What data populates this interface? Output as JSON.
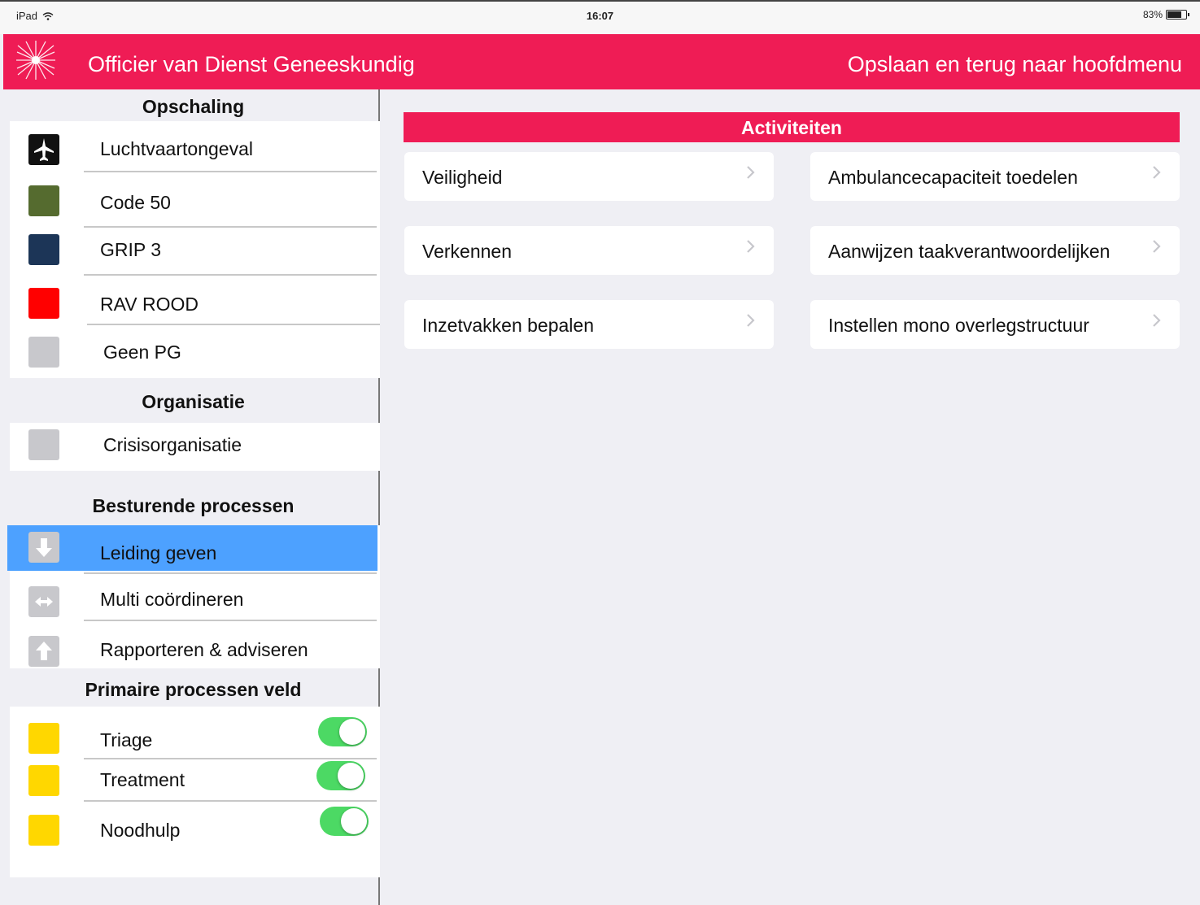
{
  "status_bar": {
    "carrier": "iPad",
    "time": "16:07",
    "battery_text": "83%",
    "battery_level": 0.83
  },
  "header": {
    "title": "Officier van Dienst Geneeskundig",
    "save_back_label": "Opslaan en terug naar hoofdmenu",
    "accent_color": "#ef1c55"
  },
  "sidebar": {
    "sections": {
      "opschaling": "Opschaling",
      "organisatie": "Organisatie",
      "besturende": "Besturende processen",
      "primaire": "Primaire processen veld"
    },
    "opschaling_items": [
      {
        "label": "Luchtvaartongeval",
        "color": "#111111",
        "icon": "airplane-icon"
      },
      {
        "label": "Code 50",
        "color": "#556b2f",
        "icon": "color-square"
      },
      {
        "label": "GRIP 3",
        "color": "#1c3557",
        "icon": "color-square"
      },
      {
        "label": "RAV ROOD",
        "color": "#ff0000",
        "icon": "color-square"
      },
      {
        "label": "Geen PG",
        "color": "#c8c8cc",
        "icon": "color-square"
      }
    ],
    "organisatie_items": [
      {
        "label": "Crisisorganisatie",
        "color": "#c8c8cc"
      }
    ],
    "besturende_items": [
      {
        "label": "Leiding geven",
        "icon": "arrow-down-icon",
        "selected": true
      },
      {
        "label": "Multi coördineren",
        "icon": "arrow-left-right-icon",
        "selected": false
      },
      {
        "label": "Rapporteren & adviseren",
        "icon": "arrow-up-icon",
        "selected": false
      }
    ],
    "primaire_items": [
      {
        "label": "Triage",
        "color": "#ffd700",
        "toggle_on": true
      },
      {
        "label": "Treatment",
        "color": "#ffd700",
        "toggle_on": true
      },
      {
        "label": "Noodhulp",
        "color": "#ffd700",
        "toggle_on": true
      }
    ]
  },
  "main": {
    "section_title": "Activiteiten",
    "activities_left": [
      "Veiligheid",
      "Verkennen",
      "Inzetvakken bepalen"
    ],
    "activities_right": [
      "Ambulancecapaciteit toedelen",
      "Aanwijzen taakverantwoordelijken",
      "Instellen mono overlegstructuur"
    ]
  }
}
